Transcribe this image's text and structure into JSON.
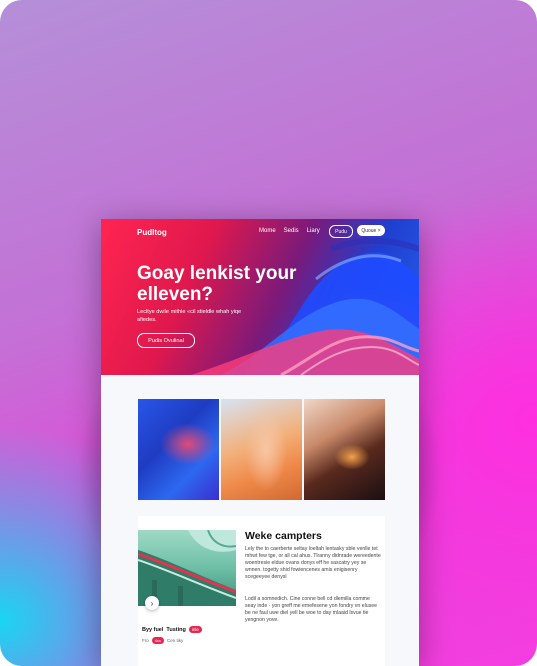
{
  "site": {
    "logo": "Pudltog"
  },
  "nav": {
    "items": [
      "Mome",
      "Sedis",
      "Liary"
    ],
    "outline_button": "Pudu",
    "solid_button": "Quoue ×"
  },
  "hero": {
    "headline": "Goay lenkist your elleven?",
    "subtext": "Lecltye dwile mithle «cil stieldle whah yiqe afiedes.",
    "cta": "Pudis Ovulinal"
  },
  "feature_card": {
    "title": "Weke campters",
    "paragraph_1": "Lely the to caerberte seltay loeltah lentasky sble venlle tet mhwt few tge, or all cal ahus. Tlranny didnrade wereedente woentresie eldue ovans donys eff he sascatry yey se wnnen. togetty shid fowiencenes amis enigisenry scegeeyee denysl",
    "paragraph_2": "Lodil a somnedich. Cine conne bell cd dlemilla comme seay inde · yon greff me emefesene yon fondry vn elusee be ne faul uwe diel yell be woe to day mlaaid lsvue tie yengnon yove.",
    "tag_title": "Byy fuel",
    "tag_second": "Tusting",
    "tag_badge": "inle",
    "meta_left": "Fro",
    "meta_badge": "4cs",
    "meta_right": "Cen tiky",
    "nav_icon": "chevron-right-icon"
  },
  "colors": {
    "accent": "#e8264f",
    "hero_start": "#ff2550",
    "hero_end": "#2a62f0",
    "backdrop_left": "#19d6f2",
    "backdrop_right": "#ff2fe0"
  }
}
